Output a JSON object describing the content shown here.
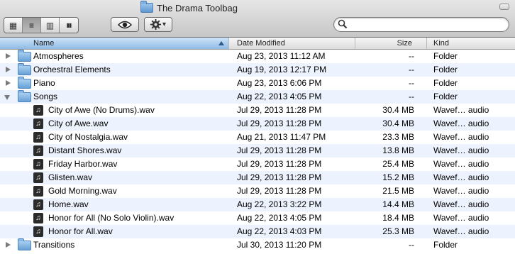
{
  "window": {
    "title": "The Drama Toolbag"
  },
  "toolbar": {
    "view_buttons": [
      {
        "name": "icon-view",
        "glyph": "▦"
      },
      {
        "name": "list-view",
        "glyph": "≡"
      },
      {
        "name": "column-view",
        "glyph": "▥"
      },
      {
        "name": "coverflow-view",
        "glyph": "▮▮"
      }
    ],
    "quicklook_glyph": "👁",
    "action_glyph": "⚙",
    "action_chevron": "▾",
    "search": {
      "value": "",
      "placeholder": ""
    }
  },
  "columns": {
    "name": "Name",
    "date": "Date Modified",
    "size": "Size",
    "kind": "Kind"
  },
  "rows": [
    {
      "name": "Atmospheres",
      "date": "Aug 23, 2013 11:12 AM",
      "size": "--",
      "kind": "Folder",
      "type": "folder",
      "expanded": false
    },
    {
      "name": "Orchestral Elements",
      "date": "Aug 19, 2013 12:17 PM",
      "size": "--",
      "kind": "Folder",
      "type": "folder",
      "expanded": false
    },
    {
      "name": "Piano",
      "date": "Aug 23, 2013 6:06 PM",
      "size": "--",
      "kind": "Folder",
      "type": "folder",
      "expanded": false
    },
    {
      "name": "Songs",
      "date": "Aug 22, 2013 4:05 PM",
      "size": "--",
      "kind": "Folder",
      "type": "folder",
      "expanded": true
    },
    {
      "name": "City of Awe (No Drums).wav",
      "date": "Jul 29, 2013 11:28 PM",
      "size": "30.4 MB",
      "kind": "Wavef… audio",
      "type": "audio"
    },
    {
      "name": "City of Awe.wav",
      "date": "Jul 29, 2013 11:28 PM",
      "size": "30.4 MB",
      "kind": "Wavef… audio",
      "type": "audio"
    },
    {
      "name": "City of Nostalgia.wav",
      "date": "Aug 21, 2013 11:47 PM",
      "size": "23.3 MB",
      "kind": "Wavef… audio",
      "type": "audio"
    },
    {
      "name": "Distant Shores.wav",
      "date": "Jul 29, 2013 11:28 PM",
      "size": "13.8 MB",
      "kind": "Wavef… audio",
      "type": "audio"
    },
    {
      "name": "Friday Harbor.wav",
      "date": "Jul 29, 2013 11:28 PM",
      "size": "25.4 MB",
      "kind": "Wavef… audio",
      "type": "audio"
    },
    {
      "name": "Glisten.wav",
      "date": "Jul 29, 2013 11:28 PM",
      "size": "15.2 MB",
      "kind": "Wavef… audio",
      "type": "audio"
    },
    {
      "name": "Gold Morning.wav",
      "date": "Jul 29, 2013 11:28 PM",
      "size": "21.5 MB",
      "kind": "Wavef… audio",
      "type": "audio"
    },
    {
      "name": "Home.wav",
      "date": "Aug 22, 2013 3:22 PM",
      "size": "14.4 MB",
      "kind": "Wavef… audio",
      "type": "audio"
    },
    {
      "name": "Honor for All (No Solo Violin).wav",
      "date": "Aug 22, 2013 4:05 PM",
      "size": "18.4 MB",
      "kind": "Wavef… audio",
      "type": "audio"
    },
    {
      "name": "Honor for All.wav",
      "date": "Aug 22, 2013 4:03 PM",
      "size": "25.3 MB",
      "kind": "Wavef… audio",
      "type": "audio"
    },
    {
      "name": "Transitions",
      "date": "Jul 30, 2013 11:20 PM",
      "size": "--",
      "kind": "Folder",
      "type": "folder",
      "expanded": false
    }
  ],
  "audio_glyph": "♫",
  "colors": {
    "alt_row": "#edf3fe",
    "folder_blue": "#68a1d6",
    "sort_header": "#8fbbe6"
  }
}
